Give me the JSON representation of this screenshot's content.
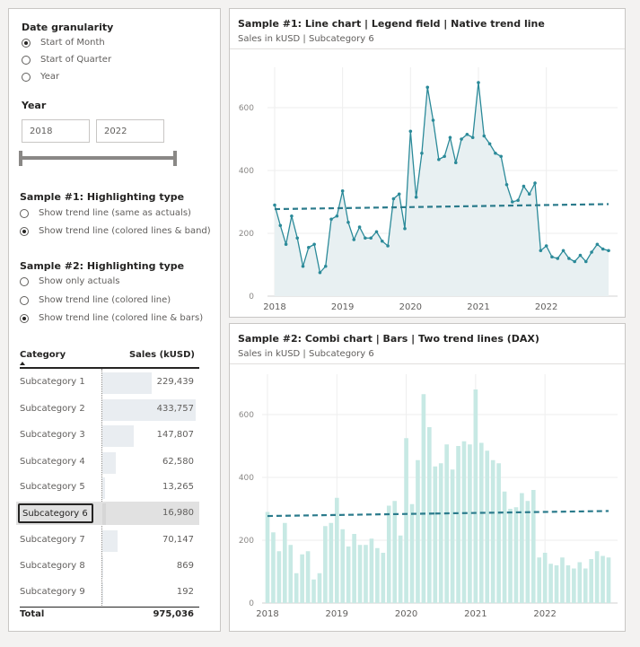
{
  "slicers": {
    "date_granularity": {
      "title": "Date granularity",
      "options": [
        {
          "label": "Start of Month",
          "selected": true
        },
        {
          "label": "Start of Quarter",
          "selected": false
        },
        {
          "label": "Year",
          "selected": false
        }
      ]
    },
    "year": {
      "title": "Year",
      "from": "2018",
      "to": "2022"
    },
    "sample1": {
      "title": "Sample #1: Highlighting type",
      "options": [
        {
          "label": "Show trend line (same as actuals)",
          "selected": false
        },
        {
          "label": "Show trend line (colored lines & band)",
          "selected": true
        }
      ]
    },
    "sample2": {
      "title": "Sample #2: Highlighting type",
      "options": [
        {
          "label": "Show only actuals",
          "selected": false
        },
        {
          "label": "Show trend line (colored line)",
          "selected": false
        },
        {
          "label": "Show trend line (colored line & bars)",
          "selected": true
        }
      ]
    }
  },
  "table": {
    "col_category": "Category",
    "col_sales": "Sales (kUSD)",
    "rows": [
      {
        "label": "Subcategory 1",
        "value": "229,439",
        "num": 229439
      },
      {
        "label": "Subcategory 2",
        "value": "433,757",
        "num": 433757
      },
      {
        "label": "Subcategory 3",
        "value": "147,807",
        "num": 147807
      },
      {
        "label": "Subcategory 4",
        "value": "62,580",
        "num": 62580
      },
      {
        "label": "Subcategory 5",
        "value": "13,265",
        "num": 13265
      },
      {
        "label": "Subcategory 6",
        "value": "16,980",
        "num": 16980
      },
      {
        "label": "Subcategory 7",
        "value": "70,147",
        "num": 70147
      },
      {
        "label": "Subcategory 8",
        "value": "869",
        "num": 869
      },
      {
        "label": "Subcategory 9",
        "value": "192",
        "num": 192
      }
    ],
    "selected_row": "Subcategory 6",
    "total_label": "Total",
    "total_value": "975,036"
  },
  "card1": {
    "title": "Sample #1: Line chart | Legend field | Native trend line",
    "subtitle": "Sales in kUSD | Subcategory 6"
  },
  "card2": {
    "title": "Sample #2: Combi chart | Bars | Two trend lines (DAX)",
    "subtitle": "Sales in kUSD | Subcategory 6"
  },
  "colors": {
    "line": "#2b8a99",
    "area": "#e8f0f2",
    "bar": "#c7e9e4",
    "trend": "#2b7b8c",
    "grid": "#eeeeee"
  },
  "chart_data": [
    {
      "type": "line",
      "x_ticks": [
        "2018",
        "2019",
        "2020",
        "2021",
        "2022"
      ],
      "y_ticks": [
        "0",
        "200",
        "400",
        "600"
      ],
      "ylim": [
        0,
        700
      ],
      "start": "2018-01",
      "values": [
        290,
        225,
        165,
        255,
        185,
        95,
        155,
        165,
        75,
        95,
        245,
        255,
        335,
        235,
        180,
        220,
        185,
        185,
        205,
        175,
        160,
        310,
        325,
        215,
        525,
        315,
        455,
        665,
        560,
        435,
        445,
        505,
        425,
        500,
        515,
        505,
        680,
        510,
        485,
        455,
        445,
        355,
        300,
        305,
        350,
        325,
        360,
        145,
        160,
        125,
        120,
        145,
        120,
        110,
        130,
        110,
        140,
        165,
        150,
        145
      ],
      "trend": [
        277,
        293
      ]
    },
    {
      "type": "bar",
      "x_ticks": [
        "2018",
        "2019",
        "2020",
        "2021",
        "2022"
      ],
      "y_ticks": [
        "0",
        "200",
        "400",
        "600"
      ],
      "ylim": [
        0,
        700
      ],
      "start": "2018-01",
      "values": [
        290,
        225,
        165,
        255,
        185,
        95,
        155,
        165,
        75,
        95,
        245,
        255,
        335,
        235,
        180,
        220,
        185,
        185,
        205,
        175,
        160,
        310,
        325,
        215,
        525,
        315,
        455,
        665,
        560,
        435,
        445,
        505,
        425,
        500,
        515,
        505,
        680,
        510,
        485,
        455,
        445,
        355,
        300,
        305,
        350,
        325,
        360,
        145,
        160,
        125,
        120,
        145,
        120,
        110,
        130,
        110,
        140,
        165,
        150,
        145
      ],
      "trend_lines": [
        [
          277,
          285
        ],
        [
          285,
          293
        ]
      ]
    }
  ]
}
